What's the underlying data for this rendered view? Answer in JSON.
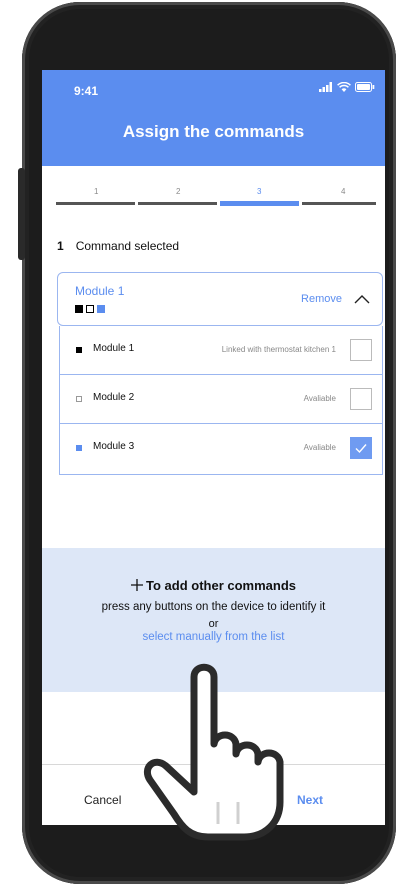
{
  "status_bar": {
    "time": "9:41"
  },
  "header": {
    "title": "Assign the commands"
  },
  "stepper": {
    "steps": [
      "1",
      "2",
      "3",
      "4"
    ],
    "active_step": 3
  },
  "selection": {
    "count": "1",
    "label": "Command selected"
  },
  "module_card": {
    "name": "Module 1",
    "remove_label": "Remove",
    "squares": [
      "filled",
      "empty",
      "blue"
    ]
  },
  "modules": [
    {
      "name": "Module 1",
      "status": "Linked with thermostat kitchen 1",
      "bullet": "filled",
      "checked": false
    },
    {
      "name": "Module 2",
      "status": "Avaliable",
      "bullet": "empty",
      "checked": false
    },
    {
      "name": "Module 3",
      "status": "Avaliable",
      "bullet": "blue",
      "checked": true
    }
  ],
  "add_panel": {
    "title": "To add other commands",
    "description": "press any buttons on the device to identify it",
    "or": "or",
    "link": "select manually from the list"
  },
  "footer": {
    "cancel": "Cancel",
    "next": "Next"
  },
  "colors": {
    "primary": "#5b8def",
    "panel_bg": "#dde7f7"
  },
  "icons": [
    "signal-icon",
    "wifi-icon",
    "battery-icon",
    "chevron-up-icon",
    "check-icon",
    "plus-icon",
    "pointing-hand-icon"
  ]
}
